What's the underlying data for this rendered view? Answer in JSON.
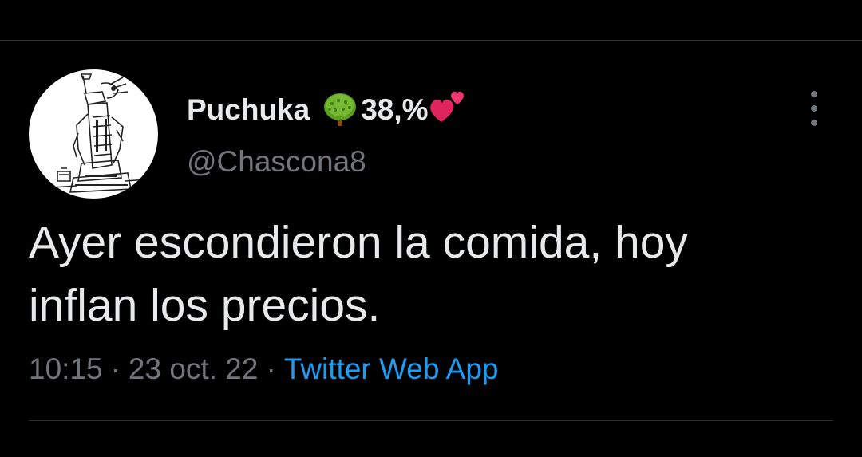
{
  "tweet": {
    "author": {
      "display_name": "Puchuka",
      "name_emoji_1": "deciduous-tree-emoji",
      "name_suffix": "38,%",
      "name_emoji_2": "two-hearts-emoji",
      "handle": "@Chascona8",
      "avatar": "statue-drawing-avatar"
    },
    "text_line_1": "Ayer escondieron la comida, hoy",
    "text_line_2": "inflan los precios.",
    "time": "10:15",
    "separator_1": "·",
    "date": "23 oct. 22",
    "separator_2": "·",
    "source": "Twitter Web App",
    "more_icon": "ellipsis-vertical-icon"
  },
  "colors": {
    "background": "#000000",
    "primary_text": "#e7e9ea",
    "secondary_text": "#71767b",
    "link": "#1d9bf0",
    "divider": "#2f3336"
  }
}
